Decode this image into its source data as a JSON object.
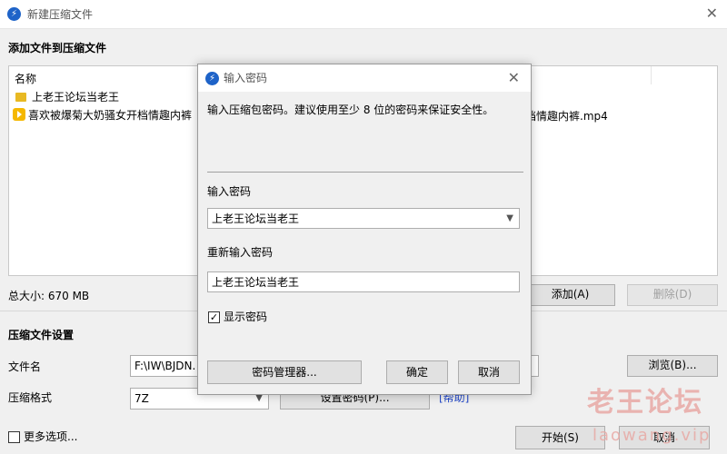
{
  "window": {
    "title": "新建压缩文件",
    "close_icon": "close-icon"
  },
  "add_section": {
    "title": "添加文件到压缩文件",
    "column_name": "名称",
    "files": [
      {
        "name": "上老王论坛当老王",
        "icon": "folder-icon"
      },
      {
        "name": "喜欢被爆菊大奶骚女开档情趣内裤",
        "icon": "video-file-icon"
      }
    ],
    "file_name_tail": "档情趣内裤.mp4",
    "total_size": "总大小: 670 MB",
    "add_button": "添加(A)",
    "delete_button": "删除(D)"
  },
  "settings": {
    "title": "压缩文件设置",
    "filename_label": "文件名",
    "filename_value": "F:\\IW\\BJDN.",
    "browse_button": "浏览(B)...",
    "format_label": "压缩格式",
    "format_value": "7Z",
    "set_password_button": "设置密码(P)...",
    "help_link": "[帮助]"
  },
  "footer": {
    "more_options_label": "更多选项...",
    "more_options_checked": false,
    "start_button": "开始(S)",
    "cancel_button": "取消"
  },
  "watermark": {
    "text": "老王论坛",
    "subtext": "laowang.vip"
  },
  "password_dialog": {
    "title": "输入密码",
    "instruction": "输入压缩包密码。建议使用至少 8 位的密码来保证安全性。",
    "password_label": "输入密码",
    "password_value": "上老王论坛当老王",
    "confirm_label": "重新输入密码",
    "confirm_value": "上老王论坛当老王",
    "show_password_label": "显示密码",
    "show_password_checked": true,
    "manager_button": "密码管理器...",
    "ok_button": "确定",
    "cancel_button": "取消"
  },
  "colors": {
    "accent": "#1e63c8",
    "link": "#2046c8",
    "watermark": "#e8a9a5"
  }
}
